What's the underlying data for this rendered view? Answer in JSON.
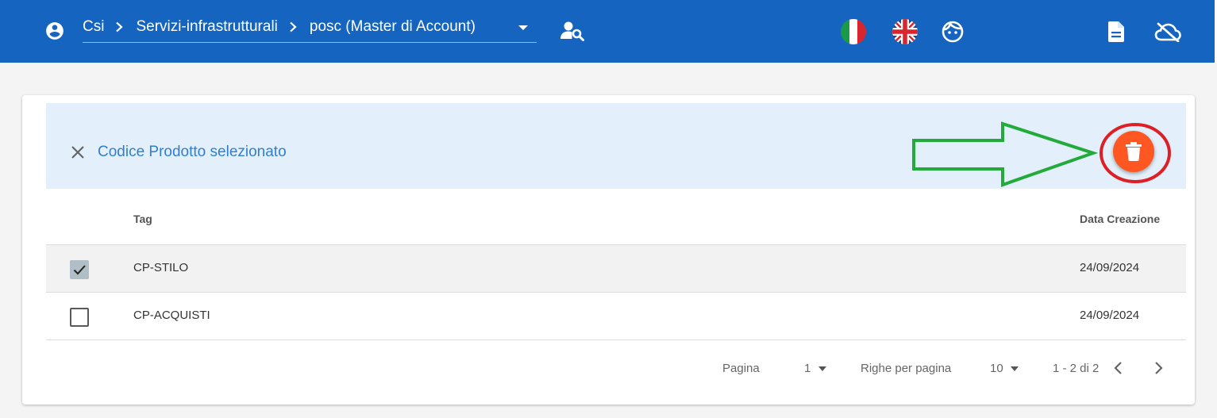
{
  "header": {
    "breadcrumbs": [
      "Csi",
      "Servizi-infrastrutturali",
      "posc (Master di Account)"
    ],
    "icons": {
      "account": "account-circle-icon",
      "user_search": "user-search-icon",
      "flag_italian": "italian-flag-icon",
      "flag_english": "uk-flag-icon",
      "face": "face-icon",
      "document": "document-icon",
      "cloud_off": "cloud-off-icon"
    },
    "background_color": "#1565c0"
  },
  "selection_bar": {
    "text": "Codice Prodotto selezionato",
    "delete_button_color": "#ff5722"
  },
  "table": {
    "columns": [
      "Tag",
      "Data Creazione"
    ],
    "rows": [
      {
        "tag": "CP-STILO",
        "date": "24/09/2024",
        "checked": true
      },
      {
        "tag": "CP-ACQUISTI",
        "date": "24/09/2024",
        "checked": false
      }
    ]
  },
  "pagination": {
    "page_label": "Pagina",
    "page_value": "1",
    "rows_label": "Righe per pagina",
    "rows_value": "10",
    "range": "1 - 2 di 2"
  },
  "annotations": {
    "arrow_color": "#22aa3a",
    "circle_color": "#dd1f26"
  }
}
